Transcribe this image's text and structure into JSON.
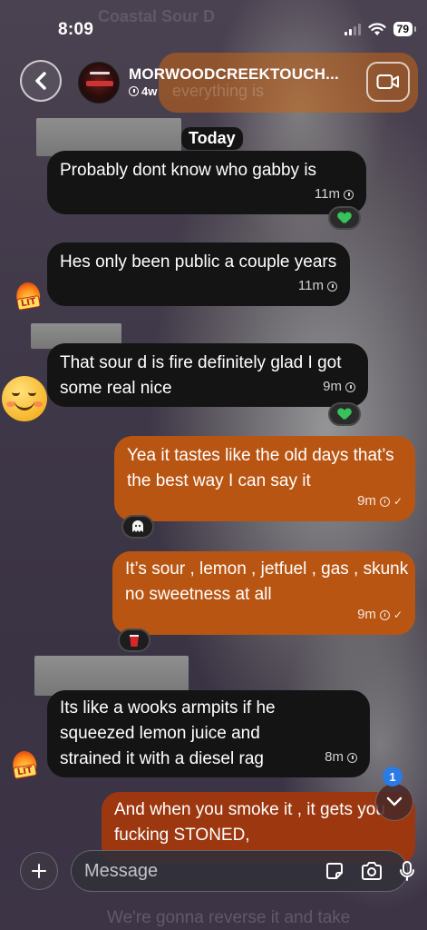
{
  "status_bar": {
    "time": "8:09",
    "battery": "79"
  },
  "background_text": {
    "title": "Coastal Sour D",
    "message": "everything is",
    "bottom": "We're gonna reverse it and take"
  },
  "header": {
    "username": "MORWOODCREEKTOUCH...",
    "last_seen": "4w",
    "back_icon": "chevron-left-icon",
    "video_icon": "video-camera-icon"
  },
  "conversation": {
    "date_separator": "Today",
    "messages": [
      {
        "direction": "received",
        "text": "Probably dont know who gabby is",
        "time": "11m",
        "reaction": "green-heart"
      },
      {
        "direction": "received",
        "text": "Hes only been public a couple years",
        "time": "11m",
        "sticker": "lit-flame"
      },
      {
        "direction": "received",
        "text": "That sour d is fire definitely glad I got some real nice",
        "time": "9m",
        "reaction": "green-heart",
        "sticker": "blushing-smiley"
      },
      {
        "direction": "sent",
        "text": "Yea it tastes like the old days that’s the best way I can say it",
        "time": "9m",
        "reaction": "ghost-emoji"
      },
      {
        "direction": "sent",
        "text": "It’s sour , lemon , jetfuel , gas , skunk no sweetness at all",
        "time": "9m",
        "reaction": "red-cup-emoji"
      },
      {
        "direction": "received",
        "text": "Its like a wooks armpits if he squeezed lemon juice and strained it with a diesel rag",
        "time": "8m",
        "sticker": "lit-flame"
      },
      {
        "direction": "sent",
        "text": "And when you smoke it , it gets you fucking STONED,",
        "time": ""
      }
    ]
  },
  "scroll_down": {
    "unread_count": "1"
  },
  "composer": {
    "placeholder": "Message",
    "icons": [
      "sticker-icon",
      "camera-icon",
      "microphone-icon"
    ]
  },
  "colors": {
    "received_bubble": "#141414",
    "sent_bubble": "#b95512",
    "sent_bubble_deep": "#9c3710",
    "reaction_green": "#35c35a",
    "badge_blue": "#2b7be6"
  }
}
